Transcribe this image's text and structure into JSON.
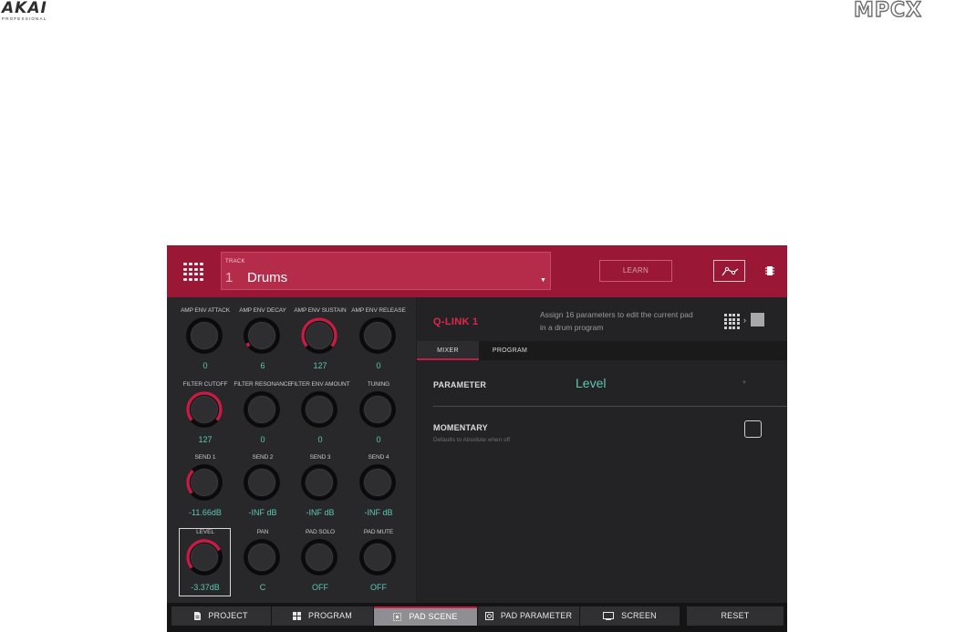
{
  "brand": {
    "left_logo": "AKAI",
    "left_sub": "PROFESSIONAL",
    "right_logo": "MPCX"
  },
  "header": {
    "track_label": "TRACK",
    "track_number": "1",
    "track_name": "Drums",
    "learn_label": "LEARN"
  },
  "knobs": [
    {
      "label": "AMP ENV ATTACK",
      "value": "0",
      "level": 0.0,
      "red": false
    },
    {
      "label": "AMP ENV DECAY",
      "value": "6",
      "level": 0.05,
      "red": false
    },
    {
      "label": "AMP ENV SUSTAIN",
      "value": "127",
      "level": 1.0,
      "red": true
    },
    {
      "label": "AMP ENV RELEASE",
      "value": "0",
      "level": 0.0,
      "red": false
    },
    {
      "label": "FILTER CUTOFF",
      "value": "127",
      "level": 1.0,
      "red": true
    },
    {
      "label": "FILTER RESONANCE",
      "value": "0",
      "level": 0.0,
      "red": false
    },
    {
      "label": "FILTER ENV AMOUNT",
      "value": "0",
      "level": 0.0,
      "red": false
    },
    {
      "label": "TUNING",
      "value": "0",
      "level": 0.0,
      "red": false
    },
    {
      "label": "SEND 1",
      "value": "-11.66dB",
      "level": 0.33,
      "red": true
    },
    {
      "label": "SEND 2",
      "value": "-INF dB",
      "level": 0.0,
      "red": false
    },
    {
      "label": "SEND 3",
      "value": "-INF dB",
      "level": 0.0,
      "red": false
    },
    {
      "label": "SEND 4",
      "value": "-INF dB",
      "level": 0.0,
      "red": false
    },
    {
      "label": "LEVEL",
      "value": "-3.37dB",
      "level": 0.75,
      "red": true
    },
    {
      "label": "PAN",
      "value": "C",
      "level": 0.0,
      "red": false
    },
    {
      "label": "PAD SOLO",
      "value": "OFF",
      "level": 0.0,
      "red": false
    },
    {
      "label": "PAD MUTE",
      "value": "OFF",
      "level": 0.0,
      "red": false
    }
  ],
  "qlink": {
    "title": "Q-LINK 1",
    "description": "Assign 16 parameters to edit the current pad in a drum program",
    "tabs": [
      "MIXER",
      "PROGRAM"
    ],
    "parameter_label": "PARAMETER",
    "parameter_value": "Level",
    "momentary_label": "MOMENTARY",
    "momentary_sub": "Defaults to Absolute when off"
  },
  "bottom": {
    "project": "PROJECT",
    "program": "PROGRAM",
    "pad_scene": "PAD SCENE",
    "pad_parameter": "PAD PARAMETER",
    "screen": "SCREEN",
    "reset": "RESET"
  },
  "colors": {
    "accent": "#c21e45",
    "header": "#9a1835",
    "value_teal": "#5ec7b3"
  }
}
